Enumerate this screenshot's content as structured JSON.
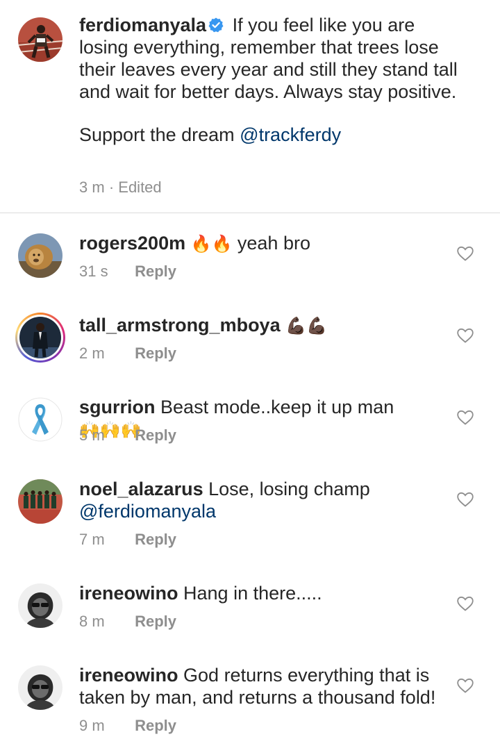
{
  "caption": {
    "username": "ferdiomanyala",
    "verified_icon": "verified-badge-icon",
    "text": "If you feel like you are losing everything,  remember that trees lose their leaves every year and still they stand tall and wait for better days. Always stay positive.",
    "support_text": "Support the dream",
    "support_mention": "@trackferdy",
    "time": "3 m",
    "separator": "·",
    "edited": "Edited"
  },
  "comments": [
    {
      "username": "rogers200m",
      "text": "yeah bro",
      "emoji": "🔥🔥",
      "time": "31 s",
      "reply_label": "Reply",
      "like_icon": "heart-outline-icon"
    },
    {
      "username": "tall_armstrong_mboya",
      "text": "",
      "emoji": "💪🏿💪🏿",
      "time": "2 m",
      "reply_label": "Reply",
      "like_icon": "heart-outline-icon"
    },
    {
      "username": "sgurrion",
      "text": "Beast mode..keep it up man",
      "emoji": "🙌🙌🙌",
      "time": "5 m",
      "reply_label": "Reply",
      "like_icon": "heart-outline-icon"
    },
    {
      "username": "noel_alazarus",
      "text": "Lose, losing champ",
      "mention": "@ferdiomanyala",
      "time": "7 m",
      "reply_label": "Reply",
      "like_icon": "heart-outline-icon"
    },
    {
      "username": "ireneowino",
      "text": "Hang in there.....",
      "time": "8 m",
      "reply_label": "Reply",
      "like_icon": "heart-outline-icon"
    },
    {
      "username": "ireneowino",
      "text": "God returns everything that is taken by man, and returns a thousand fold!",
      "time": "9 m",
      "reply_label": "Reply",
      "like_icon": "heart-outline-icon"
    }
  ],
  "colors": {
    "text": "#262626",
    "meta": "#8e8e8e",
    "mention": "#00376b",
    "verified": "#3897f0",
    "divider": "#dbdbdb"
  }
}
